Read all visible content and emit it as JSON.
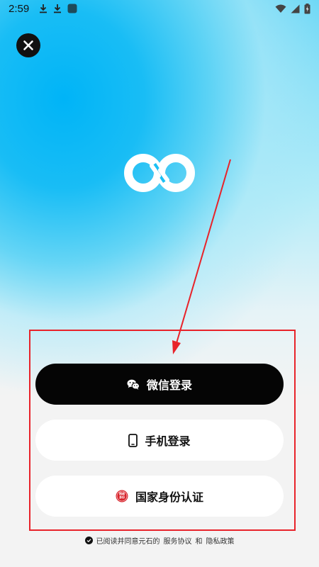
{
  "status_bar": {
    "time": "2:59",
    "left_icons": [
      "download-icon",
      "download-icon",
      "app-icon"
    ],
    "right_icons": [
      "wifi-icon",
      "signal-icon",
      "battery-icon"
    ]
  },
  "header": {
    "close_icon": "close-icon"
  },
  "brand": {
    "logo_icon": "infinity-logo-icon"
  },
  "login": {
    "wechat_label": "微信登录",
    "phone_label": "手机登录",
    "id_label": "国家身份认证",
    "id_badge_text": "网络身份"
  },
  "agreement": {
    "prefix": "已阅读并同意元石的",
    "service": "服务协议",
    "and": "和",
    "privacy": "隐私政策"
  },
  "colors": {
    "primary_black": "#050505",
    "accent_blue": "#00b4f7",
    "highlight_red": "#e8232a",
    "background": "#f3f3f3"
  }
}
